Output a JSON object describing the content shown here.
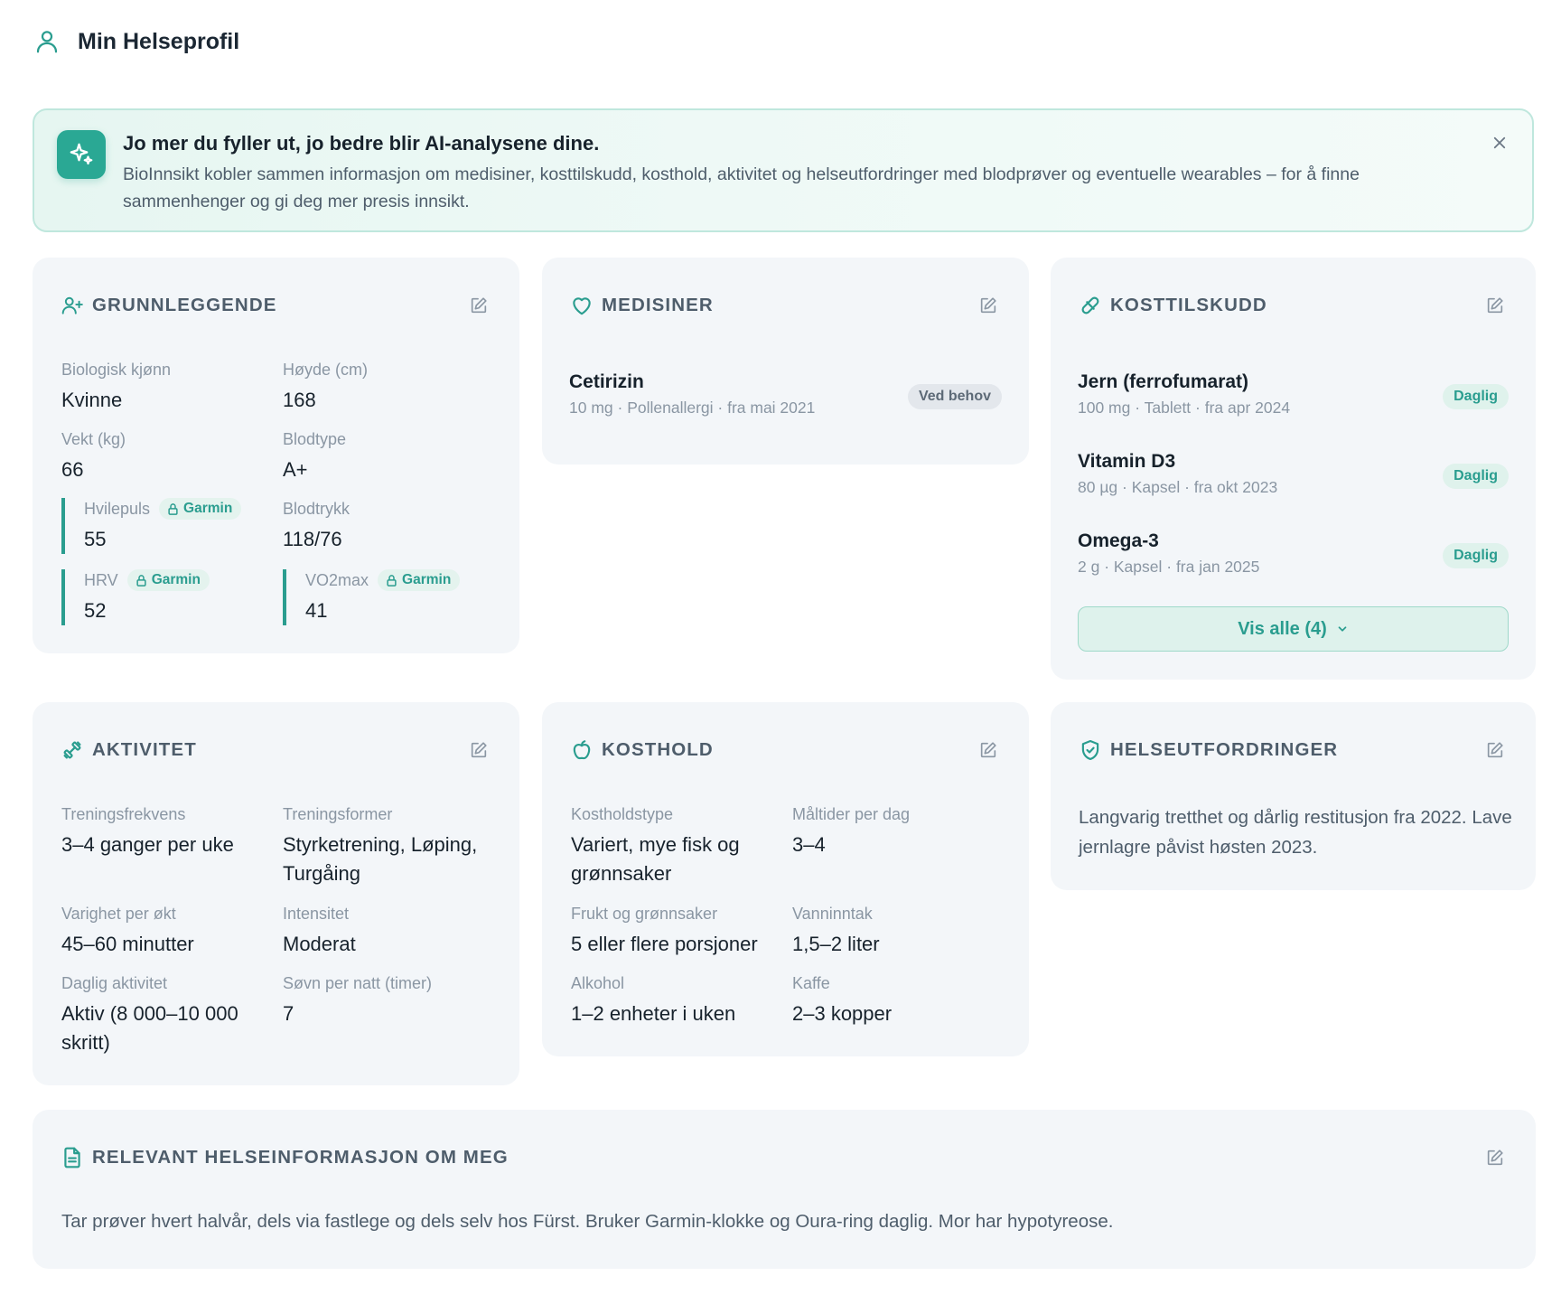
{
  "header": {
    "title": "Min Helseprofil",
    "icon": "user-icon"
  },
  "banner": {
    "title": "Jo mer du fyller ut, jo bedre blir AI-analysene dine.",
    "text": "BioInnsikt kobler sammen informasjon om medisiner, kosttilskudd, kosthold, aktivitet og helseutfordringer med blodprøver og eventuelle wearables – for å finne sammenhenger og gi deg mer presis innsikt.",
    "icon": "sparkle-icon",
    "close_icon": "close-icon"
  },
  "colors": {
    "accent": "#2a9d8f",
    "card_bg": "#f3f6f9",
    "banner_bg": "#e6f6f1",
    "muted": "#8a96a3",
    "text": "#17222c"
  },
  "grunnleggende": {
    "title": "GRUNNLEGGENDE",
    "icon": "user-plus-icon",
    "fields": {
      "kjonn": {
        "label": "Biologisk kjønn",
        "value": "Kvinne"
      },
      "hoyde": {
        "label": "Høyde (cm)",
        "value": "168"
      },
      "vekt": {
        "label": "Vekt (kg)",
        "value": "66"
      },
      "blodtype": {
        "label": "Blodtype",
        "value": "A+"
      },
      "hvilepuls": {
        "label": "Hvilepuls",
        "value": "55",
        "source": "Garmin"
      },
      "blodtrykk": {
        "label": "Blodtrykk",
        "value": "118/76"
      },
      "hrv": {
        "label": "HRV",
        "value": "52",
        "source": "Garmin"
      },
      "vo2max": {
        "label": "VO2max",
        "value": "41",
        "source": "Garmin"
      }
    }
  },
  "medisiner": {
    "title": "MEDISINER",
    "icon": "heart-icon",
    "items": [
      {
        "name": "Cetirizin",
        "detail": "10 mg · Pollenallergi · fra mai 2021",
        "badge": "Ved behov"
      }
    ]
  },
  "kosttilskudd": {
    "title": "KOSTTILSKUDD",
    "icon": "pill-icon",
    "items": [
      {
        "name": "Jern (ferrofumarat)",
        "detail": "100 mg · Tablett · fra apr 2024",
        "badge": "Daglig"
      },
      {
        "name": "Vitamin D3",
        "detail": "80 µg · Kapsel · fra okt 2023",
        "badge": "Daglig"
      },
      {
        "name": "Omega-3",
        "detail": "2 g · Kapsel · fra jan 2025",
        "badge": "Daglig"
      }
    ],
    "show_all": "Vis alle (4)"
  },
  "aktivitet": {
    "title": "AKTIVITET",
    "icon": "dumbbell-icon",
    "fields": {
      "frekvens": {
        "label": "Treningsfrekvens",
        "value": "3–4 ganger per uke"
      },
      "former": {
        "label": "Treningsformer",
        "value": "Styrketrening, Løping, Turgåing"
      },
      "varighet": {
        "label": "Varighet per økt",
        "value": "45–60 minutter"
      },
      "intensitet": {
        "label": "Intensitet",
        "value": "Moderat"
      },
      "daglig": {
        "label": "Daglig aktivitet",
        "value": "Aktiv (8 000–10 000 skritt)"
      },
      "sovn": {
        "label": "Søvn per natt (timer)",
        "value": "7"
      }
    }
  },
  "kosthold": {
    "title": "KOSTHOLD",
    "icon": "apple-icon",
    "fields": {
      "type": {
        "label": "Kostholdstype",
        "value": "Variert, mye fisk og grønnsaker"
      },
      "maltider": {
        "label": "Måltider per dag",
        "value": "3–4"
      },
      "frukt": {
        "label": "Frukt og grønnsaker",
        "value": "5 eller flere porsjoner"
      },
      "vann": {
        "label": "Vanninntak",
        "value": "1,5–2 liter"
      },
      "alkohol": {
        "label": "Alkohol",
        "value": "1–2 enheter i uken"
      },
      "kaffe": {
        "label": "Kaffe",
        "value": "2–3 kopper"
      }
    }
  },
  "helseutfordringer": {
    "title": "HELSEUTFORDRINGER",
    "icon": "shield-check-icon",
    "text": "Langvarig tretthet og dårlig restitusjon fra 2022. Lave jernlagre påvist høsten 2023."
  },
  "relevant": {
    "title": "RELEVANT HELSEINFORMASJON OM MEG",
    "icon": "document-icon",
    "text": "Tar prøver hvert halvår, dels via fastlege og dels selv hos Fürst. Bruker Garmin-klokke og Oura-ring daglig. Mor har hypotyreose."
  }
}
